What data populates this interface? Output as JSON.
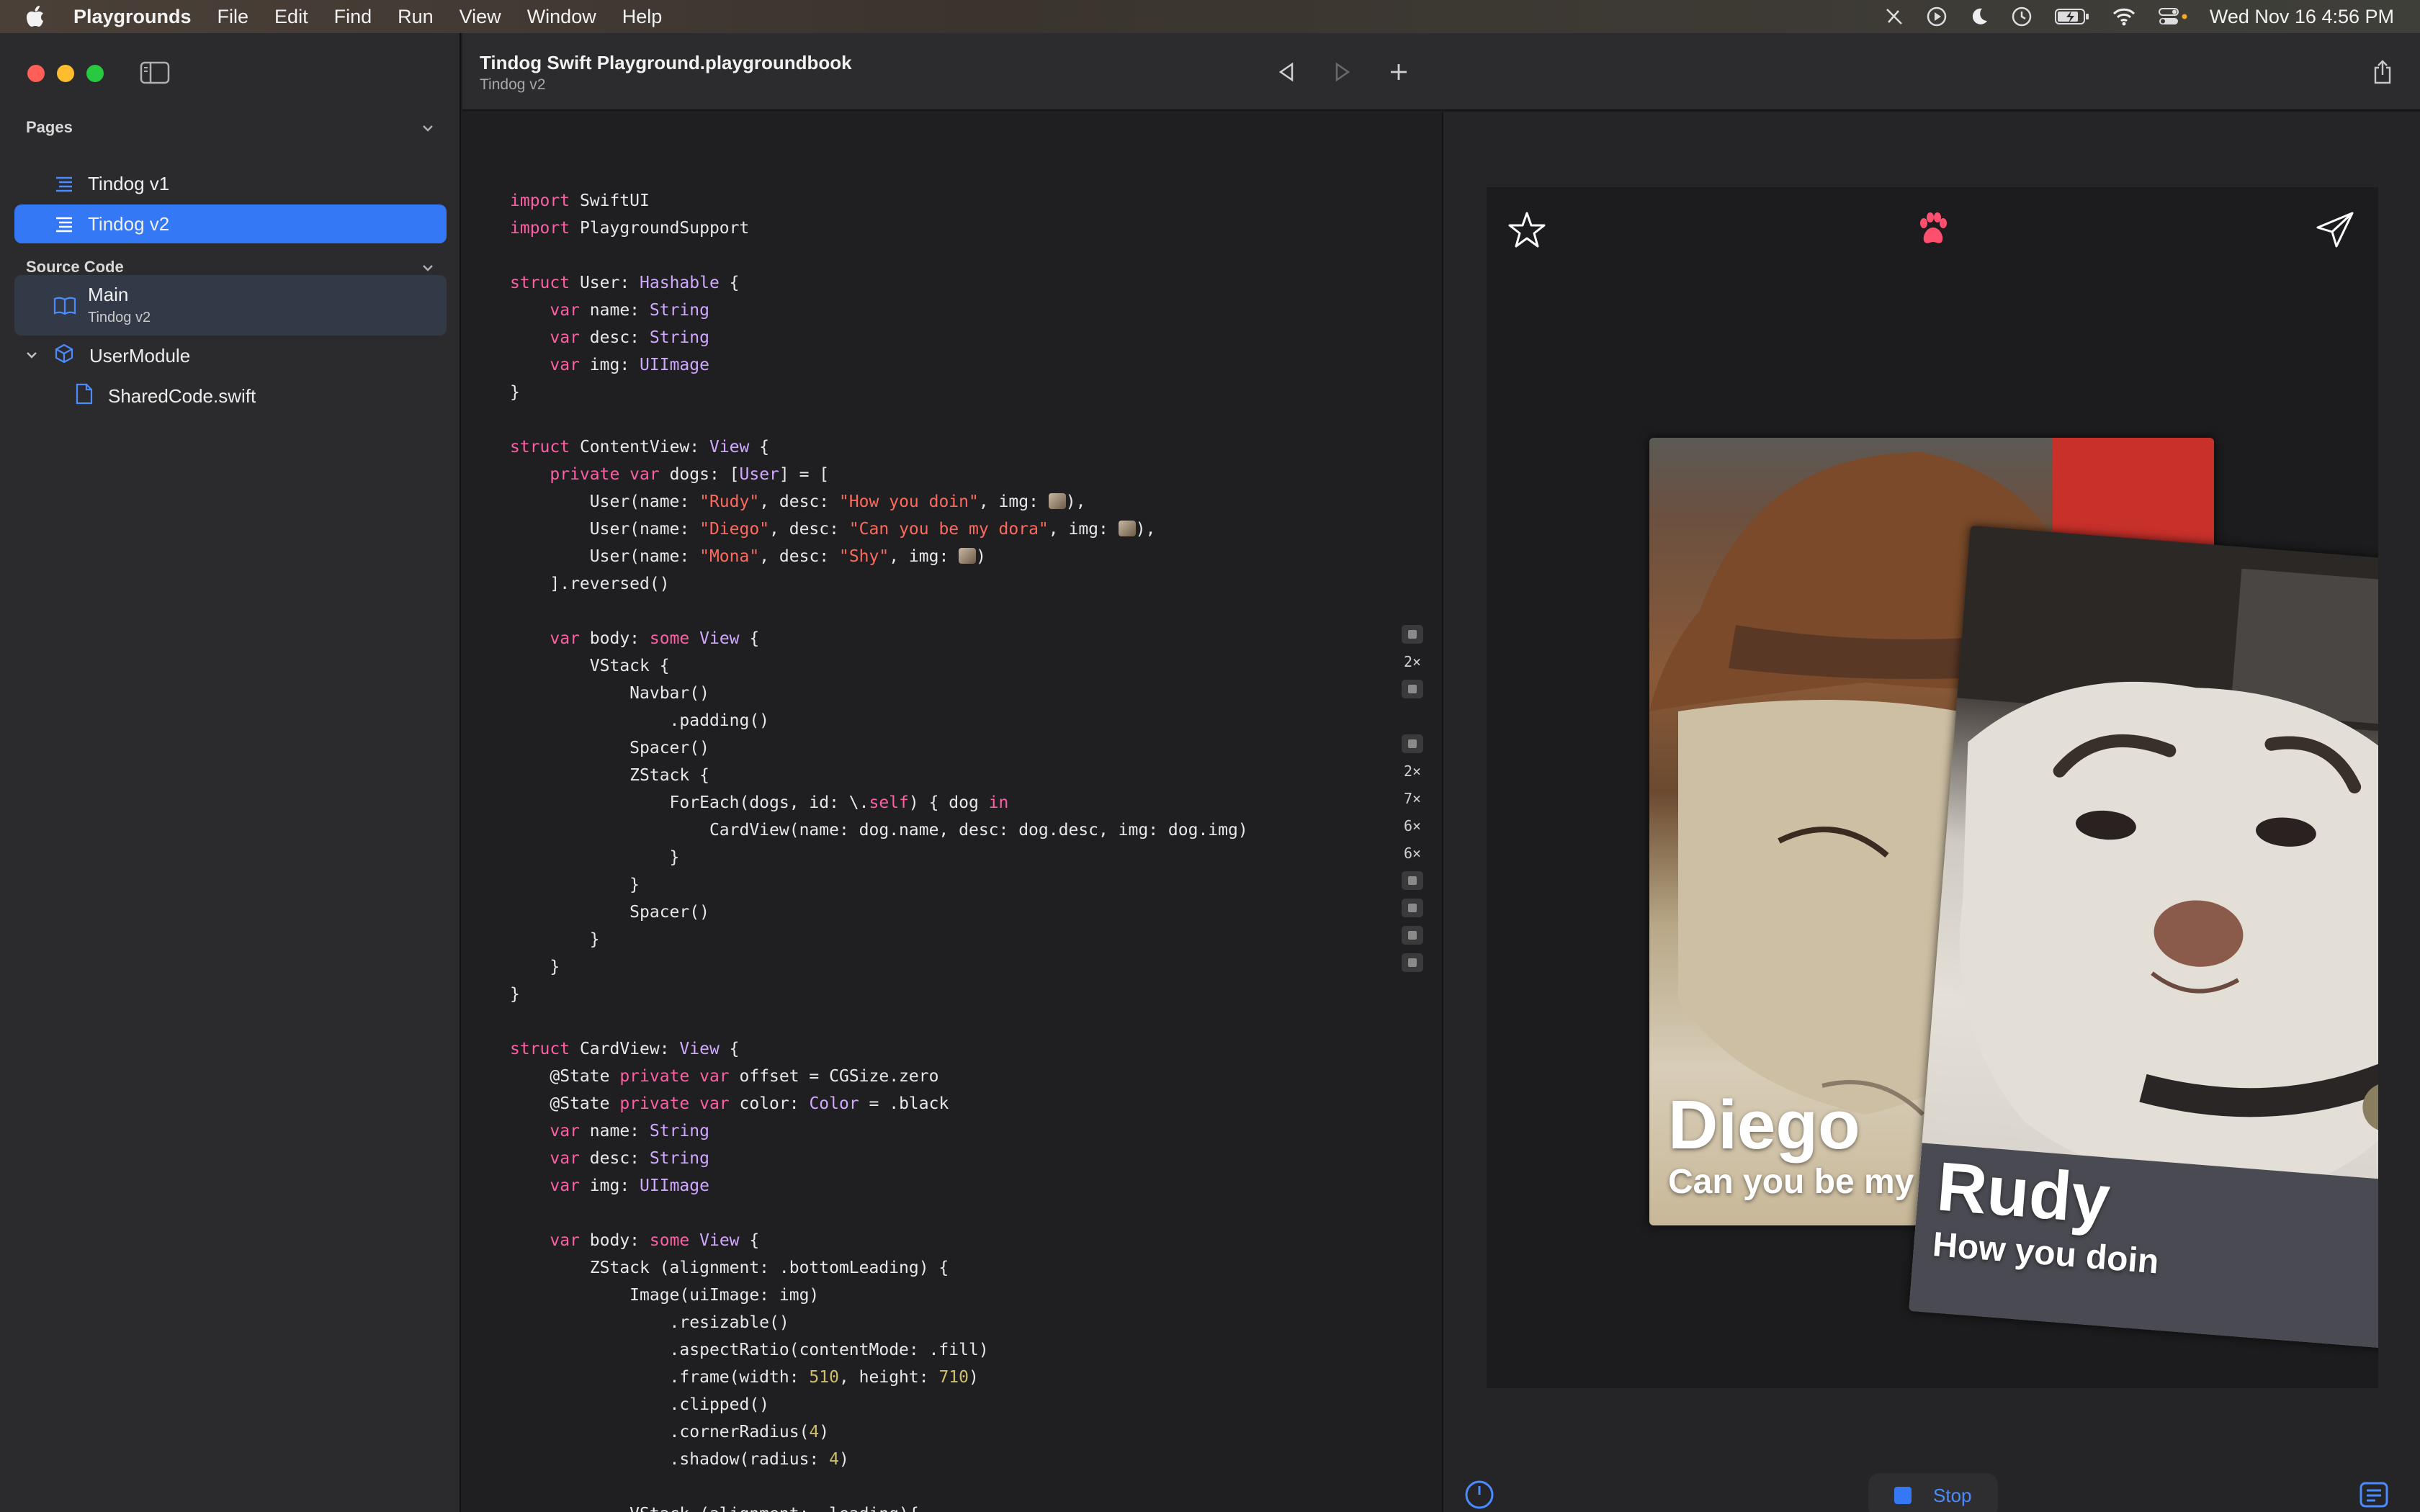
{
  "menubar": {
    "app_name": "Playgrounds",
    "menus": [
      "File",
      "Edit",
      "Find",
      "Run",
      "View",
      "Window",
      "Help"
    ],
    "clock": "Wed Nov 16  4:56 PM"
  },
  "sidebar": {
    "pages_header": "Pages",
    "pages": [
      {
        "label": "Tindog v1"
      },
      {
        "label": "Tindog v2"
      }
    ],
    "source_header": "Source Code",
    "main_item": {
      "label": "Main",
      "sublabel": "Tindog v2"
    },
    "module": {
      "label": "UserModule"
    },
    "shared_file": {
      "label": "SharedCode.swift"
    }
  },
  "editor": {
    "title": "Tindog Swift Playground.playgroundbook",
    "subtitle": "Tindog v2"
  },
  "gutter": {
    "b1": "2×",
    "b2": "2×",
    "b3": "7×",
    "b4": "6×",
    "b5": "6×"
  },
  "preview": {
    "cards": [
      {
        "name": "Diego",
        "desc": "Can you be my dora"
      },
      {
        "name": "Rudy",
        "desc": "How you doin"
      }
    ],
    "stop_label": "Stop"
  },
  "colors": {
    "accent": "#3478f6",
    "paw": "#ff4f6e",
    "keyword": "#fc5fa3",
    "string": "#fc6a5d"
  }
}
